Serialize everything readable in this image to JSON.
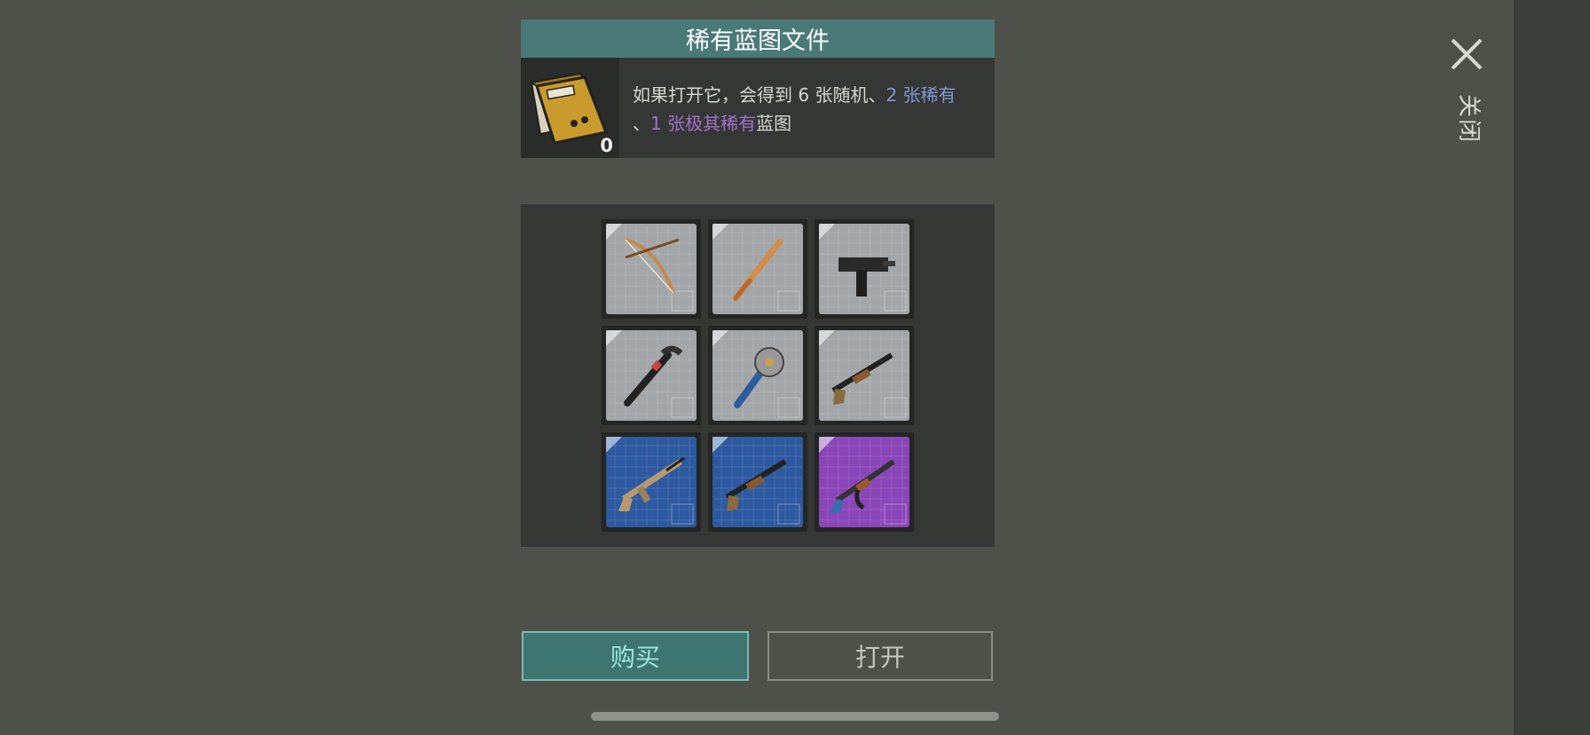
{
  "dialog": {
    "title": "稀有蓝图文件",
    "item_count": "0",
    "description": {
      "part1": "如果打开它，会得到 6 张随机、",
      "rare": "2 张稀有",
      "part2": "、",
      "epic": "1 张极其稀有",
      "part3": "蓝图"
    }
  },
  "close": {
    "label": "关闭",
    "icon": "close-icon"
  },
  "blueprints": [
    {
      "name": "bow",
      "rarity": "common"
    },
    {
      "name": "baseball-bat",
      "rarity": "common"
    },
    {
      "name": "uzi",
      "rarity": "common"
    },
    {
      "name": "crowbar",
      "rarity": "common"
    },
    {
      "name": "saw-mace",
      "rarity": "common"
    },
    {
      "name": "shotgun",
      "rarity": "common"
    },
    {
      "name": "assault-rifle",
      "rarity": "rare"
    },
    {
      "name": "shotgun",
      "rarity": "rare"
    },
    {
      "name": "ak-rifle",
      "rarity": "epic"
    }
  ],
  "buttons": {
    "buy": "购买",
    "open": "打开"
  },
  "colors": {
    "background": "#4d514a",
    "accent": "#4a7a78",
    "rare": "#7e97d3",
    "epic": "#a072c8",
    "common_card": "#a3a6a9",
    "rare_card": "#2d59a0",
    "epic_card": "#8a45b8"
  }
}
